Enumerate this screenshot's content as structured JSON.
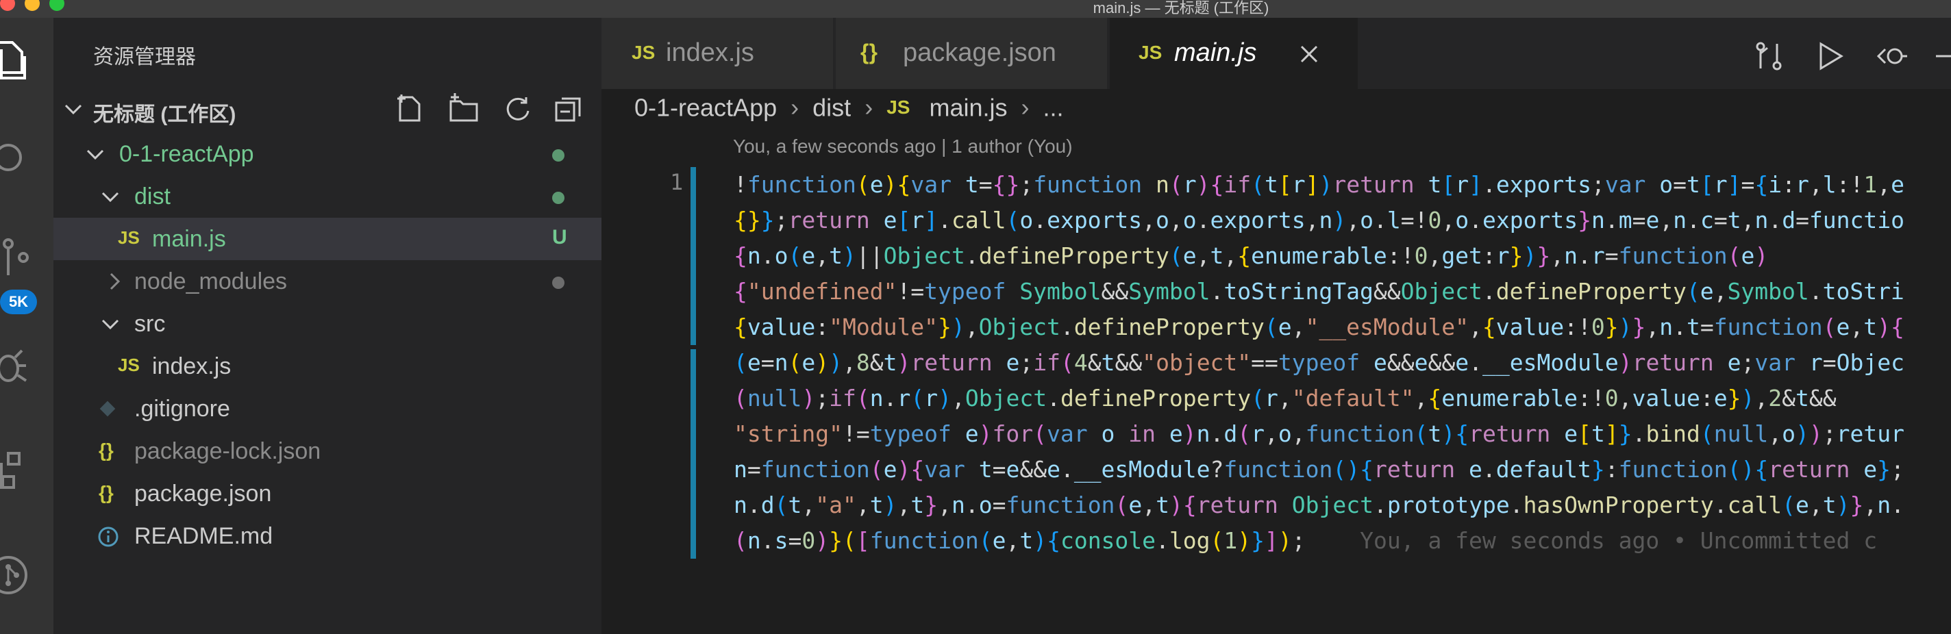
{
  "window": {
    "title": "main.js — 无标题 (工作区)"
  },
  "activity_bar": {
    "items": [
      "files-icon",
      "search-icon",
      "source-control-icon",
      "debug-icon",
      "extensions-icon",
      "git-graph-icon"
    ],
    "source_control_badge": "5K"
  },
  "explorer": {
    "title": "资源管理器",
    "workspace": "无标题 (工作区)",
    "tree": [
      {
        "label": "0-1-reactApp",
        "kind": "folder",
        "status": "dot"
      },
      {
        "label": "dist",
        "kind": "folder",
        "status": "dot"
      },
      {
        "label": "main.js",
        "kind": "js",
        "status": "U"
      },
      {
        "label": "node_modules",
        "kind": "folder",
        "status": "grey-dot"
      },
      {
        "label": "src",
        "kind": "folder"
      },
      {
        "label": "index.js",
        "kind": "js"
      },
      {
        "label": ".gitignore",
        "kind": "git"
      },
      {
        "label": "package-lock.json",
        "kind": "json"
      },
      {
        "label": "package.json",
        "kind": "json"
      },
      {
        "label": "README.md",
        "kind": "info"
      }
    ]
  },
  "tabs": [
    {
      "label": "index.js",
      "icon": "JS"
    },
    {
      "label": "package.json",
      "icon": "{}"
    },
    {
      "label": "main.js",
      "icon": "JS",
      "active": true
    }
  ],
  "breadcrumb": {
    "items": [
      "0-1-reactApp",
      "dist",
      "main.js",
      "..."
    ]
  },
  "editor": {
    "codelens": "You, a few seconds ago | 1 author (You)",
    "line_number": "1",
    "blame": "You, a few seconds ago • Uncommitted c",
    "code_lines": [
      "!function(e){var t={};function n(r){if(t[r])return t[r].exports;var o=t[r]={i:r,l:!1,e",
      "{}};return e[r].call(o.exports,o,o.exports,n),o.l=!0,o.exports}n.m=e,n.c=t,n.d=functio",
      "{n.o(e,t)||Object.defineProperty(e,t,{enumerable:!0,get:r})},n.r=function(e)",
      "{\"undefined\"!=typeof Symbol&&Symbol.toStringTag&&Object.defineProperty(e,Symbol.toStri",
      "{value:\"Module\"}),Object.defineProperty(e,\"__esModule\",{value:!0})},n.t=function(e,t){",
      "(e=n(e)),8&t)return e;if(4&t&&\"object\"==typeof e&&e&&e.__esModule)return e;var r=Objec",
      "(null);if(n.r(r),Object.defineProperty(r,\"default\",{enumerable:!0,value:e}),2&t&&",
      "\"string\"!=typeof e)for(var o in e)n.d(r,o,function(t){return e[t]}.bind(null,o));retur",
      "n=function(e){var t=e&&e.__esModule?function(){return e.default}:function(){return e};",
      "n.d(t,\"a\",t),t},n.o=function(e,t){return Object.prototype.hasOwnProperty.call(e,t)},n.",
      "(n.s=0)}([function(e,t){console.log(1)}]);"
    ]
  },
  "colors": {
    "accent": "#1b81a8",
    "badge": "#0e7ad3",
    "untracked": "#73c991",
    "js_icon": "#cbcb41"
  }
}
